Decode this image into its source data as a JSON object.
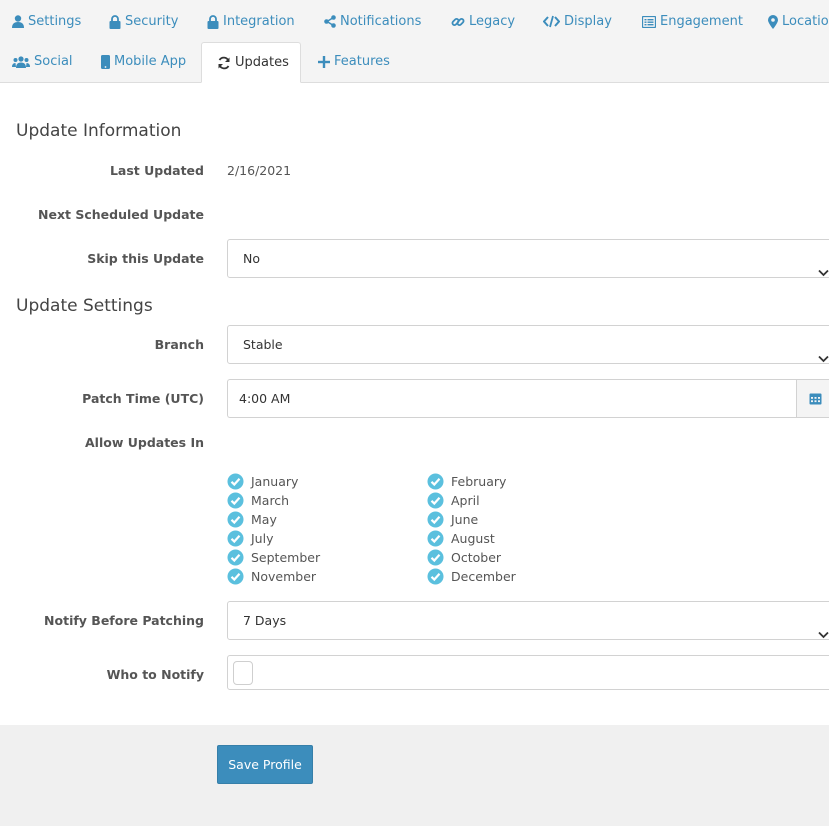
{
  "tabs": [
    {
      "label": "Settings",
      "icon": "user-icon"
    },
    {
      "label": "Security",
      "icon": "lock-icon"
    },
    {
      "label": "Integration",
      "icon": "lock-icon"
    },
    {
      "label": "Notifications",
      "icon": "share-icon"
    },
    {
      "label": "Legacy",
      "icon": "link-icon"
    },
    {
      "label": "Display",
      "icon": "code-icon"
    },
    {
      "label": "Engagement",
      "icon": "list-icon"
    },
    {
      "label": "Location",
      "icon": "map-marker-icon"
    },
    {
      "label": "Social",
      "icon": "users-icon"
    },
    {
      "label": "Mobile App",
      "icon": "mobile-icon"
    },
    {
      "label": "Updates",
      "icon": "refresh-icon",
      "active": true
    },
    {
      "label": "Features",
      "icon": "plus-icon"
    }
  ],
  "update_info": {
    "heading": "Update Information",
    "last_updated_label": "Last Updated",
    "last_updated_value": "2/16/2021",
    "next_scheduled_label": "Next Scheduled Update",
    "next_scheduled_value": "",
    "skip_label": "Skip this Update",
    "skip_value": "No"
  },
  "update_settings": {
    "heading": "Update Settings",
    "branch_label": "Branch",
    "branch_value": "Stable",
    "patch_time_label": "Patch Time (UTC)",
    "patch_time_value": "4:00 AM",
    "allow_label": "Allow Updates In",
    "months": [
      {
        "name": "January",
        "checked": true
      },
      {
        "name": "February",
        "checked": true
      },
      {
        "name": "March",
        "checked": true
      },
      {
        "name": "April",
        "checked": true
      },
      {
        "name": "May",
        "checked": true
      },
      {
        "name": "June",
        "checked": true
      },
      {
        "name": "July",
        "checked": true
      },
      {
        "name": "August",
        "checked": true
      },
      {
        "name": "September",
        "checked": true
      },
      {
        "name": "October",
        "checked": true
      },
      {
        "name": "November",
        "checked": true
      },
      {
        "name": "December",
        "checked": true
      }
    ],
    "notify_before_label": "Notify Before Patching",
    "notify_before_value": "7 Days",
    "who_label": "Who to Notify",
    "who_value": ""
  },
  "footer": {
    "save_label": "Save Profile"
  },
  "colors": {
    "accent": "#3c8dbc",
    "check": "#5bc0de",
    "tab_bar": "#f4f4f4",
    "footer": "#f0f0f0"
  }
}
